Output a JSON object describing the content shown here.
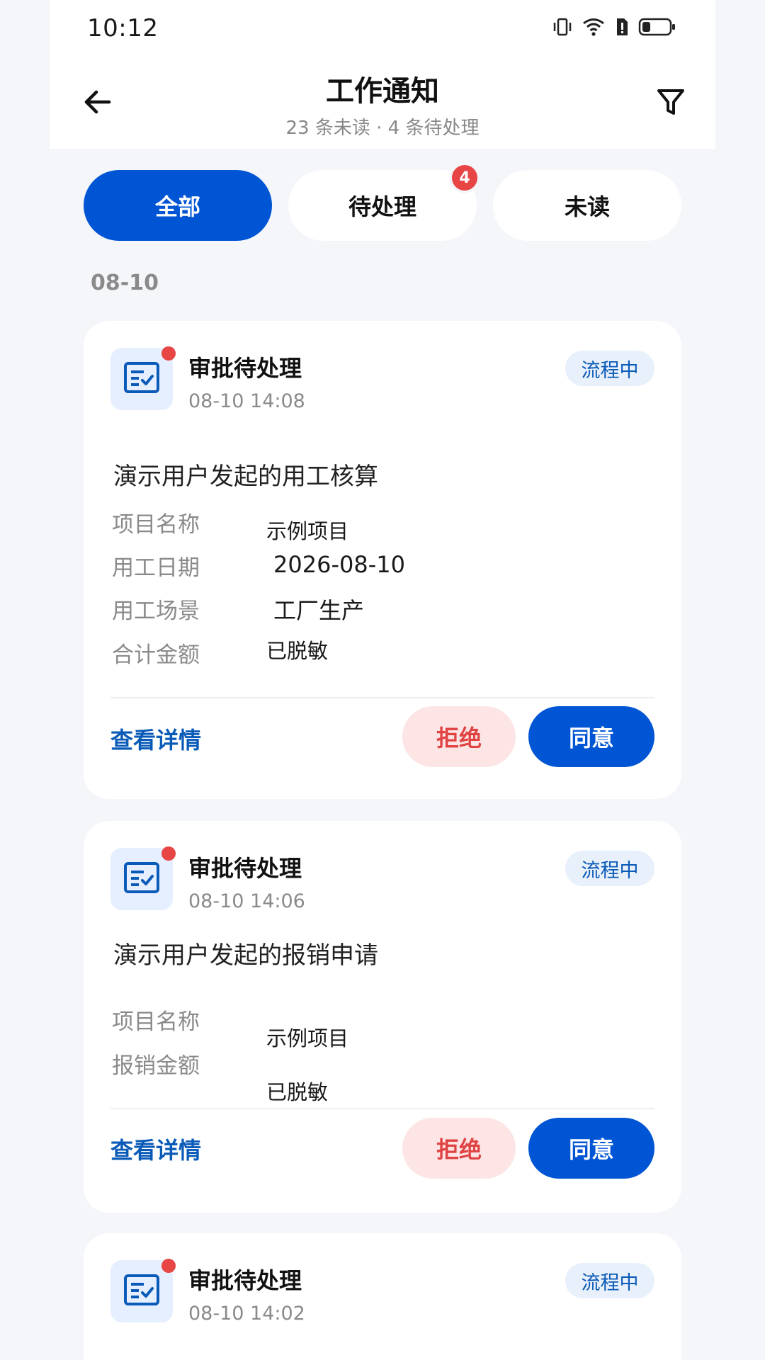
{
  "status_bar": {
    "time": "10:12",
    "icons": [
      "vibrate-icon",
      "wifi-icon",
      "battery-alert-icon",
      "battery-icon"
    ]
  },
  "header": {
    "title": "工作通知",
    "subtitle": "23 条未读 · 4 条待处理",
    "back_icon": "arrow-left-icon",
    "filter_icon": "filter-icon"
  },
  "tabs": [
    {
      "label": "全部",
      "active": true
    },
    {
      "label": "待处理",
      "badge": "4"
    },
    {
      "label": "未读"
    }
  ],
  "date_group": "08-10",
  "cards": [
    {
      "type": "审批待处理",
      "time": "08-10 14:08",
      "status": "流程中",
      "title": "演示用户发起的用工核算",
      "fields": [
        {
          "label": "项目名称",
          "value": "示例项目"
        },
        {
          "label": "用工日期",
          "value": "2026-08-10"
        },
        {
          "label": "用工场景",
          "value": "工厂生产"
        },
        {
          "label": "合计金额",
          "value": "已脱敏"
        }
      ],
      "detail_link": "查看详情",
      "reject_label": "拒绝",
      "agree_label": "同意"
    },
    {
      "type": "审批待处理",
      "time": "08-10 14:06",
      "status": "流程中",
      "title": "演示用户发起的报销申请",
      "fields": [
        {
          "label": "项目名称",
          "value": "示例项目"
        },
        {
          "label": "报销金额",
          "value": "已脱敏"
        }
      ],
      "detail_link": "查看详情",
      "reject_label": "拒绝",
      "agree_label": "同意"
    },
    {
      "type": "审批待处理",
      "time": "08-10 14:02",
      "status": "流程中"
    }
  ],
  "colors": {
    "accent": "#0055d4",
    "danger": "#e84545",
    "link": "#0a5ab8",
    "background": "#f4f6fa"
  }
}
